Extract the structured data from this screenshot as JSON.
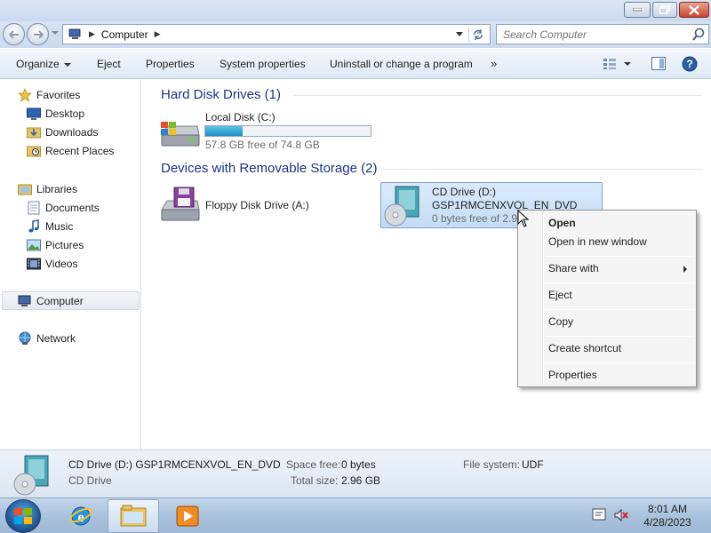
{
  "address": {
    "path": [
      "Computer"
    ],
    "search_placeholder": "Search Computer"
  },
  "toolbar": {
    "organize": "Organize",
    "eject": "Eject",
    "properties": "Properties",
    "system_properties": "System properties",
    "uninstall": "Uninstall or change a program",
    "more": "»"
  },
  "nav": {
    "favorites": "Favorites",
    "desktop": "Desktop",
    "downloads": "Downloads",
    "recent": "Recent Places",
    "libraries": "Libraries",
    "documents": "Documents",
    "music": "Music",
    "pictures": "Pictures",
    "videos": "Videos",
    "computer": "Computer",
    "network": "Network"
  },
  "groups": {
    "hdd": {
      "title": "Hard Disk Drives (1)"
    },
    "removable": {
      "title": "Devices with Removable Storage (2)"
    }
  },
  "drives": {
    "c": {
      "name": "Local Disk (C:)",
      "free": "57.8 GB free of 74.8 GB",
      "used_fraction": 0.227
    },
    "a": {
      "name": "Floppy Disk Drive (A:)"
    },
    "d": {
      "name": "CD Drive (D:)",
      "label": "GSP1RMCENXVOL_EN_DVD",
      "free": "0 bytes free of 2.96 GB"
    }
  },
  "context_menu": {
    "open": "Open",
    "open_new_window": "Open in new window",
    "share_with": "Share with",
    "eject": "Eject",
    "copy": "Copy",
    "create_shortcut": "Create shortcut",
    "properties": "Properties"
  },
  "details": {
    "title": "CD Drive (D:) GSP1RMCENXVOL_EN_DVD",
    "type": "CD Drive",
    "space_free_label": "Space free:",
    "space_free": "0 bytes",
    "total_size_label": "Total size:",
    "total_size": "2.96 GB",
    "fs_label": "File system:",
    "fs": "UDF"
  },
  "taskbar": {
    "time": "8:01 AM",
    "date": "4/28/2023"
  },
  "colors": {
    "group_header": "#1e3287",
    "selection": "#c2dcf5",
    "capacity_fill": "#1e8fc4"
  }
}
